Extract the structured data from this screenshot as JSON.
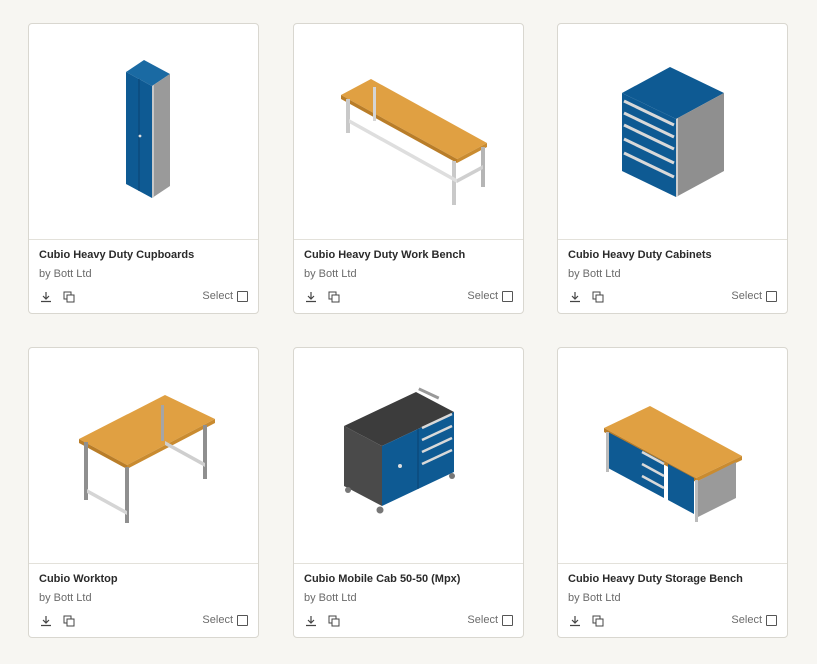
{
  "products": [
    {
      "title": "Cubio Heavy Duty Cupboards",
      "by": "by Bott Ltd",
      "select_label": "Select",
      "image_icon": "cupboard-image"
    },
    {
      "title": "Cubio Heavy Duty Work Bench",
      "by": "by Bott Ltd",
      "select_label": "Select",
      "image_icon": "work-bench-image"
    },
    {
      "title": "Cubio Heavy Duty Cabinets",
      "by": "by Bott Ltd",
      "select_label": "Select",
      "image_icon": "drawer-cabinet-image"
    },
    {
      "title": "Cubio Worktop",
      "by": "by Bott Ltd",
      "select_label": "Select",
      "image_icon": "worktop-image"
    },
    {
      "title": "Cubio Mobile Cab 50-50 (Mpx)",
      "by": "by Bott Ltd",
      "select_label": "Select",
      "image_icon": "mobile-cabinet-image"
    },
    {
      "title": "Cubio Heavy Duty Storage Bench",
      "by": "by Bott Ltd",
      "select_label": "Select",
      "image_icon": "storage-bench-image"
    }
  ],
  "colors": {
    "background": "#f7f6f2",
    "cabinet_blue": "#0e5a93",
    "wood_top": "#e0a042",
    "steel_grey": "#9a9a9a",
    "dark_grey": "#3c3c3c"
  },
  "icons": {
    "download": "download-icon",
    "copy": "copy-icon",
    "checkbox": "checkbox-icon"
  }
}
